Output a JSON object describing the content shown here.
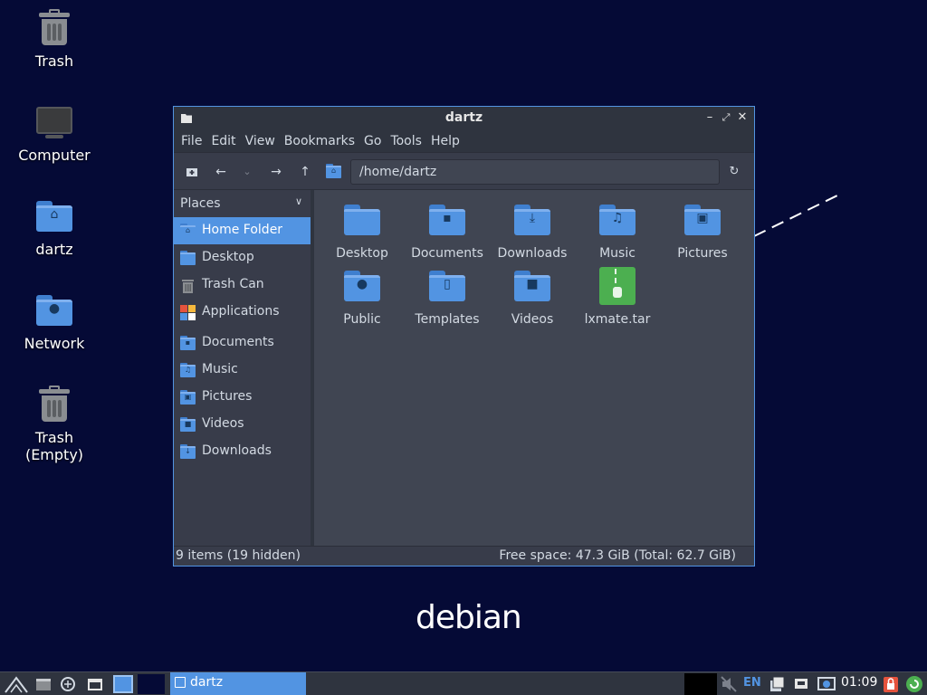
{
  "desktop": {
    "icons": [
      {
        "label": "Trash"
      },
      {
        "label": "Computer"
      },
      {
        "label": "dartz"
      },
      {
        "label": "Network"
      },
      {
        "label": "Trash\n(Empty)"
      }
    ],
    "wallpaper_text": "debian"
  },
  "window": {
    "title": "dartz",
    "menu": [
      "File",
      "Edit",
      "View",
      "Bookmarks",
      "Go",
      "Tools",
      "Help"
    ],
    "path": "/home/dartz",
    "sidebar": {
      "header": "Places",
      "items": [
        {
          "label": "Home Folder",
          "icon": "home-icon"
        },
        {
          "label": "Desktop",
          "icon": "desktop-icon"
        },
        {
          "label": "Trash Can",
          "icon": "trash-icon"
        },
        {
          "label": "Applications",
          "icon": "applications-icon"
        },
        {
          "label": "Documents",
          "icon": "documents-folder-icon"
        },
        {
          "label": "Music",
          "icon": "music-folder-icon"
        },
        {
          "label": "Pictures",
          "icon": "pictures-folder-icon"
        },
        {
          "label": "Videos",
          "icon": "videos-folder-icon"
        },
        {
          "label": "Downloads",
          "icon": "downloads-folder-icon"
        }
      ]
    },
    "files": [
      {
        "label": "Desktop",
        "icon": "desktop-folder-icon"
      },
      {
        "label": "Documents",
        "icon": "documents-folder-icon"
      },
      {
        "label": "Downloads",
        "icon": "downloads-folder-icon"
      },
      {
        "label": "Music",
        "icon": "music-folder-icon"
      },
      {
        "label": "Pictures",
        "icon": "pictures-folder-icon"
      },
      {
        "label": "Public",
        "icon": "public-folder-icon"
      },
      {
        "label": "Templates",
        "icon": "templates-folder-icon"
      },
      {
        "label": "Videos",
        "icon": "videos-folder-icon"
      },
      {
        "label": "lxmate.tar",
        "icon": "archive-icon"
      }
    ],
    "status_left": "9 items (19 hidden)",
    "status_right": "Free space: 47.3 GiB (Total: 62.7 GiB)"
  },
  "panel": {
    "task_label": "dartz",
    "keyboard_layout": "EN",
    "clock": "01:09"
  },
  "colors": {
    "accent": "#5294e2",
    "desktop_bg": "#050a36",
    "window_bg": "#383c4a",
    "content_bg": "#404552"
  }
}
